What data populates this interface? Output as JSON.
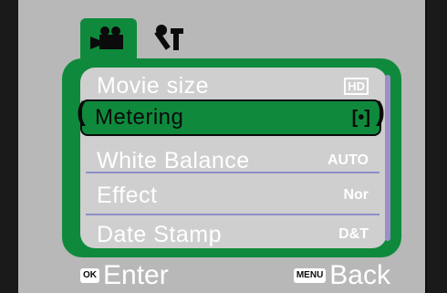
{
  "tabs": [
    {
      "icon": "movie-camera-icon",
      "active": true
    },
    {
      "icon": "setup-tools-icon",
      "active": false
    }
  ],
  "menu": {
    "items": [
      {
        "label": "Movie size",
        "value": "HD",
        "value_icon": "hd-icon"
      },
      {
        "label": "Metering",
        "value": "[•]",
        "value_icon": "metering-center-icon",
        "selected": true
      },
      {
        "label": "White Balance",
        "value": "AUTO"
      },
      {
        "label": "Effect",
        "value": "Nor"
      },
      {
        "label": "Date Stamp",
        "value": "D&T"
      }
    ]
  },
  "footer": {
    "ok_key": "OK",
    "ok_label": "Enter",
    "menu_key": "MENU",
    "menu_label": "Back"
  },
  "colors": {
    "accent_green": "#0f8a3d",
    "menu_bg": "#cfcfcf",
    "divider": "#8e8fc8"
  }
}
